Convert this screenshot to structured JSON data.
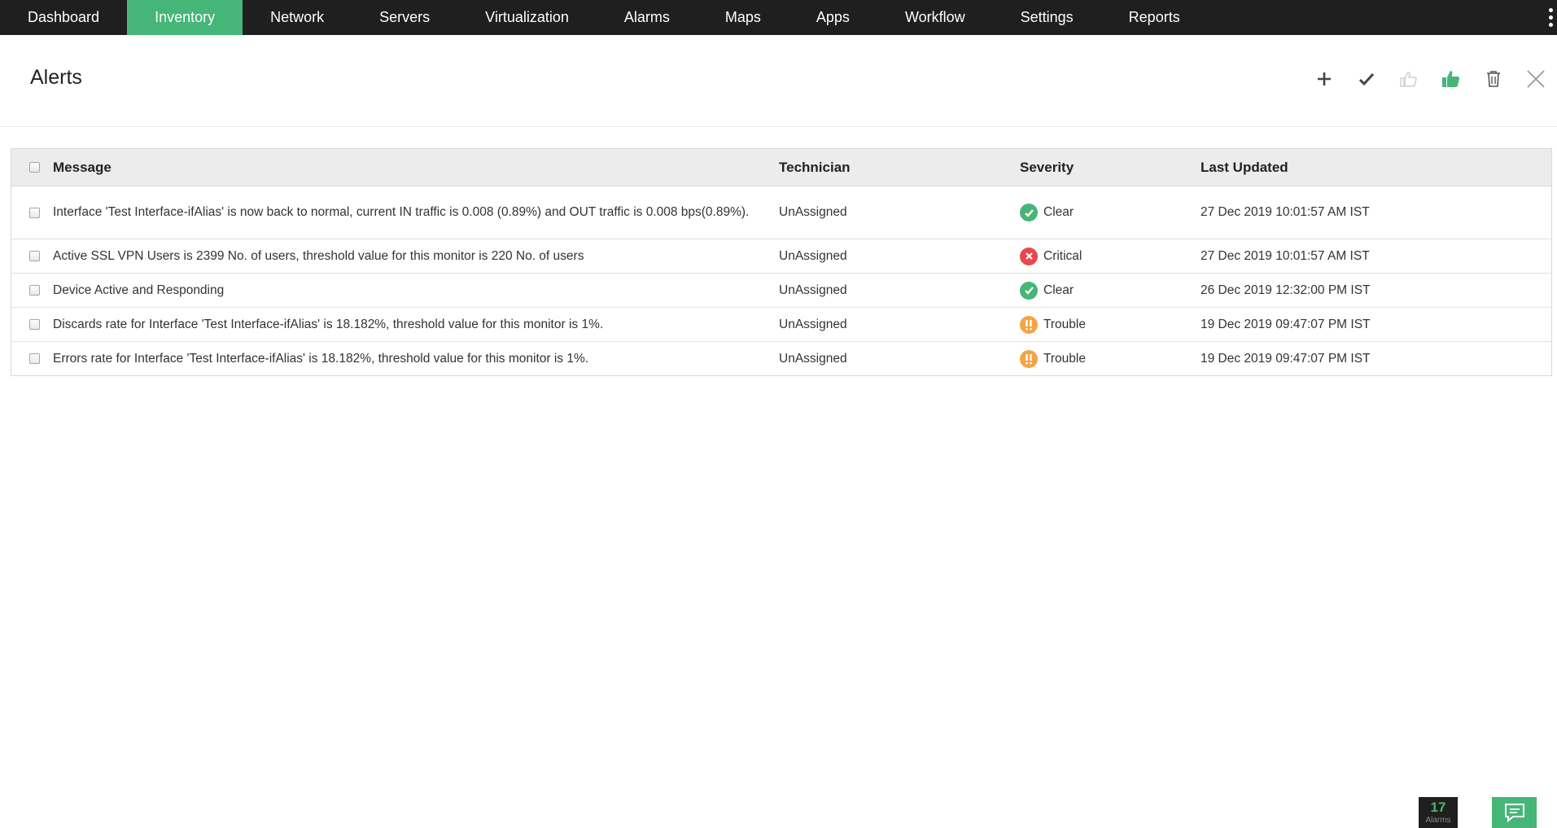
{
  "nav": {
    "items": [
      {
        "label": "Dashboard",
        "active": false
      },
      {
        "label": "Inventory",
        "active": true
      },
      {
        "label": "Network",
        "active": false
      },
      {
        "label": "Servers",
        "active": false
      },
      {
        "label": "Virtualization",
        "active": false
      },
      {
        "label": "Alarms",
        "active": false
      },
      {
        "label": "Maps",
        "active": false
      },
      {
        "label": "Apps",
        "active": false
      },
      {
        "label": "Workflow",
        "active": false
      },
      {
        "label": "Settings",
        "active": false
      },
      {
        "label": "Reports",
        "active": false
      }
    ]
  },
  "header": {
    "title": "Alerts",
    "toolbar_icons": [
      "plus-icon",
      "checkmark-icon",
      "thumbs-up-outline-icon",
      "thumbs-up-filled-icon",
      "trash-icon",
      "close-icon"
    ]
  },
  "table": {
    "columns": {
      "message": "Message",
      "technician": "Technician",
      "severity": "Severity",
      "last_updated": "Last Updated"
    },
    "rows": [
      {
        "message": "Interface 'Test Interface-ifAlias' is now back to normal, current IN traffic is 0.008 (0.89%) and OUT traffic is 0.008 bps(0.89%).",
        "technician": "UnAssigned",
        "severity": "Clear",
        "severity_icon": "check-circle-icon",
        "last_updated": "27 Dec 2019 10:01:57 AM IST"
      },
      {
        "message": "Active SSL VPN Users is 2399 No. of users, threshold value for this monitor is 220 No. of users",
        "technician": "UnAssigned",
        "severity": "Critical",
        "severity_icon": "x-circle-icon",
        "last_updated": "27 Dec 2019 10:01:57 AM IST"
      },
      {
        "message": "Device Active and Responding",
        "technician": "UnAssigned",
        "severity": "Clear",
        "severity_icon": "check-circle-icon",
        "last_updated": "26 Dec 2019 12:32:00 PM IST"
      },
      {
        "message": "Discards rate for Interface 'Test Interface-ifAlias' is 18.182%, threshold value for this monitor is 1%.",
        "technician": "UnAssigned",
        "severity": "Trouble",
        "severity_icon": "exclamation-circle-icon",
        "last_updated": "19 Dec 2019 09:47:07 PM IST"
      },
      {
        "message": "Errors rate for Interface 'Test Interface-ifAlias' is 18.182%, threshold value for this monitor is 1%.",
        "technician": "UnAssigned",
        "severity": "Trouble",
        "severity_icon": "exclamation-circle-icon",
        "last_updated": "19 Dec 2019 09:47:07 PM IST"
      }
    ]
  },
  "footer": {
    "alarm_count": "17",
    "alarm_label": "Alarms"
  },
  "colors": {
    "nav_bg": "#1f1f1f",
    "accent": "#45b677",
    "clear": "#45b677",
    "critical": "#e8474b",
    "trouble": "#f5a445"
  }
}
